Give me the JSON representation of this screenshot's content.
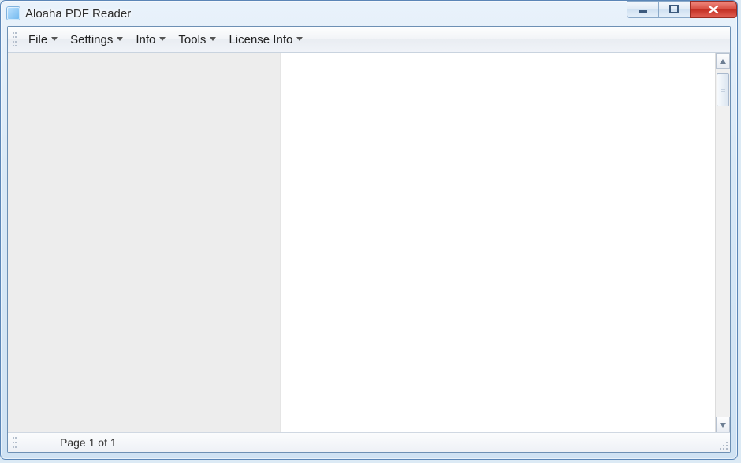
{
  "window": {
    "title": "Aloaha PDF Reader"
  },
  "menu": {
    "items": [
      {
        "label": "File"
      },
      {
        "label": "Settings"
      },
      {
        "label": "Info"
      },
      {
        "label": "Tools"
      },
      {
        "label": "License Info"
      }
    ]
  },
  "status": {
    "page_text": "Page 1 of 1"
  }
}
